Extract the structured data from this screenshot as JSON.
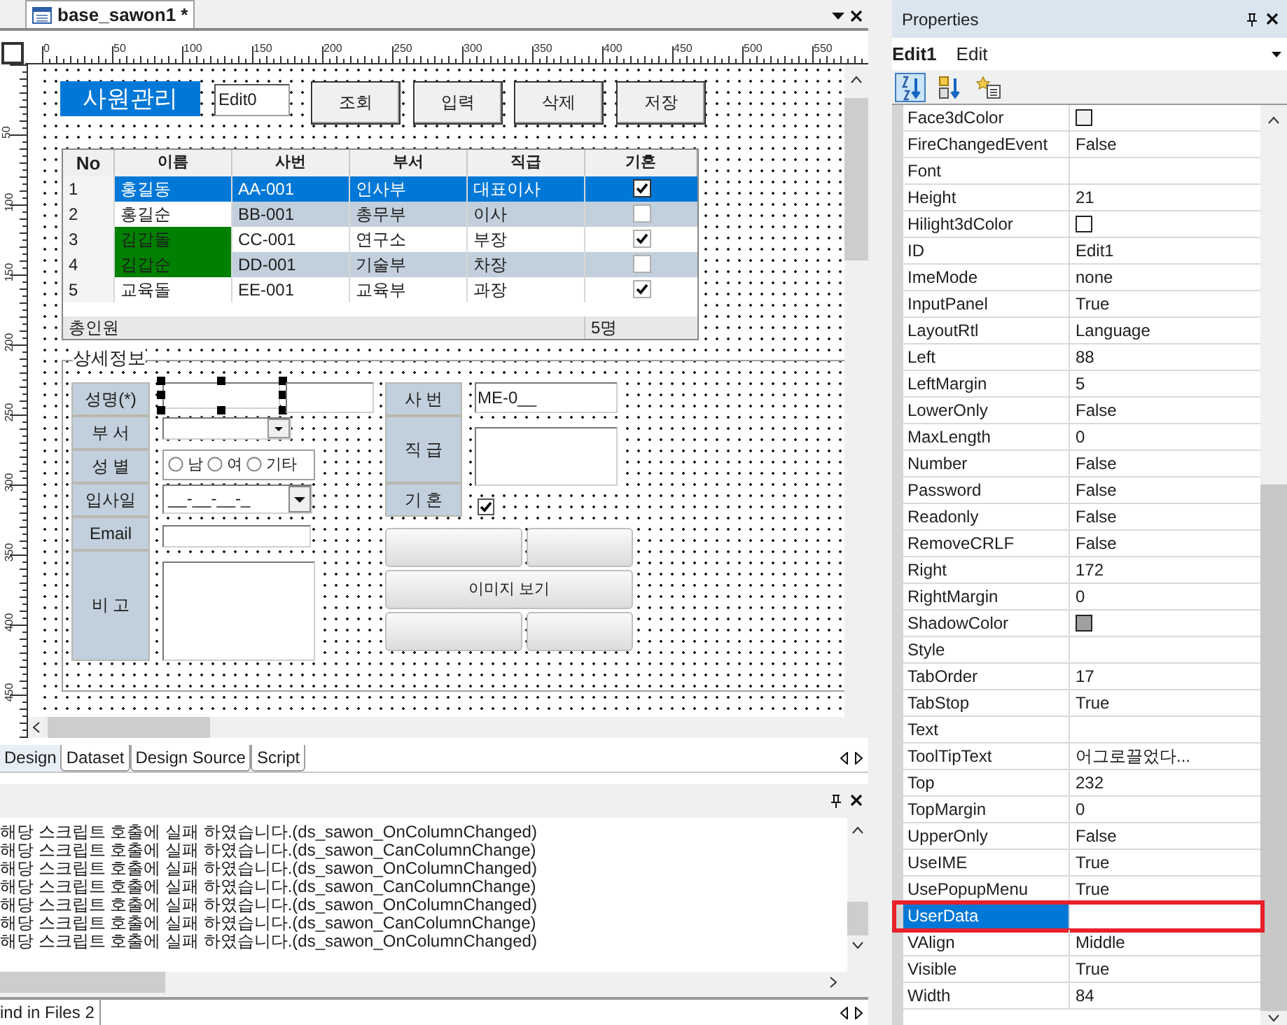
{
  "document_tab": {
    "title": "base_sawon1 *"
  },
  "ruler": {
    "horizontal": [
      "0",
      "50",
      "100",
      "150",
      "200",
      "250",
      "300",
      "350",
      "400",
      "450",
      "500",
      "550"
    ],
    "vertical": [
      "50",
      "100",
      "150",
      "200",
      "250",
      "300",
      "350",
      "400",
      "450"
    ]
  },
  "form": {
    "title": "사원관리",
    "edit0": "Edit0",
    "buttons": [
      "조회",
      "입력",
      "삭제",
      "저장"
    ],
    "grid": {
      "columns": [
        "No",
        "이름",
        "사번",
        "부서",
        "직급",
        "기혼"
      ],
      "rows": [
        {
          "no": "1",
          "name": "홍길동",
          "id": "AA-001",
          "dept": "인사부",
          "rank": "대표이사",
          "married": true,
          "selected": true,
          "striped": false,
          "highlighted": false
        },
        {
          "no": "2",
          "name": "홍길순",
          "id": "BB-001",
          "dept": "총무부",
          "rank": "이사",
          "married": false,
          "selected": false,
          "striped": true,
          "highlighted": false
        },
        {
          "no": "3",
          "name": "김갑돌",
          "id": "CC-001",
          "dept": "연구소",
          "rank": "부장",
          "married": true,
          "selected": false,
          "striped": false,
          "highlighted": true
        },
        {
          "no": "4",
          "name": "김갑순",
          "id": "DD-001",
          "dept": "기술부",
          "rank": "차장",
          "married": false,
          "selected": false,
          "striped": true,
          "highlighted": true
        },
        {
          "no": "5",
          "name": "교육돌",
          "id": "EE-001",
          "dept": "교육부",
          "rank": "과장",
          "married": true,
          "selected": false,
          "striped": false,
          "highlighted": false
        }
      ],
      "summary": {
        "label": "총인원",
        "value": "5명"
      }
    },
    "detail": {
      "legend": "상세정보",
      "labels": [
        "성명(*)",
        "부 서",
        "성 별",
        "입사일",
        "Email",
        "비 고"
      ],
      "right_labels": [
        "사 번",
        "직 급",
        "기 혼"
      ],
      "gender_options": [
        {
          "label": "남",
          "selected": false
        },
        {
          "label": "여",
          "selected": false
        },
        {
          "label": "기타",
          "selected": false
        }
      ],
      "date_mask": "__-__-__-_",
      "employee_no": "ME-0__",
      "married": true,
      "image_button": "이미지 보기"
    }
  },
  "view_tabs": [
    {
      "label": "Design",
      "selected": true
    },
    {
      "label": "Dataset",
      "selected": false
    },
    {
      "label": "Design Source",
      "selected": false
    },
    {
      "label": "Script",
      "selected": false
    }
  ],
  "output": {
    "lines": [
      "해당 스크립트 호출에 실패 하였습니다.(ds_sawon_OnColumnChanged)",
      "해당 스크립트 호출에 실패 하였습니다.(ds_sawon_CanColumnChange)",
      "해당 스크립트 호출에 실패 하였습니다.(ds_sawon_OnColumnChanged)",
      "해당 스크립트 호출에 실패 하였습니다.(ds_sawon_CanColumnChange)",
      "해당 스크립트 호출에 실패 하였습니다.(ds_sawon_OnColumnChanged)",
      "해당 스크립트 호출에 실패 하였습니다.(ds_sawon_CanColumnChange)",
      "해당 스크립트 호출에 실패 하였습니다.(ds_sawon_OnColumnChanged)"
    ]
  },
  "bottom_tab": {
    "label": "ind in Files 2"
  },
  "properties": {
    "title": "Properties",
    "object_name": "Edit1",
    "object_type": "Edit",
    "toolbar": [
      {
        "kind": "alphabetical",
        "selected": true
      },
      {
        "kind": "categorized",
        "selected": false
      },
      {
        "kind": "events",
        "selected": false
      }
    ],
    "rows": [
      {
        "name": "Face3dColor",
        "kind": "color",
        "color": "#f0f0f0",
        "selected": false,
        "marked": false
      },
      {
        "name": "FireChangedEvent",
        "kind": "text",
        "value": "False",
        "selected": false,
        "marked": false
      },
      {
        "name": "Font",
        "kind": "text",
        "selected": false,
        "marked": false
      },
      {
        "name": "Height",
        "kind": "text",
        "value": "21",
        "selected": false,
        "marked": false
      },
      {
        "name": "Hilight3dColor",
        "kind": "color",
        "color": "#ffffff",
        "selected": false,
        "marked": false
      },
      {
        "name": "ID",
        "kind": "text",
        "value": "Edit1",
        "selected": false,
        "marked": false
      },
      {
        "name": "ImeMode",
        "kind": "text",
        "value": "none",
        "selected": false,
        "marked": false
      },
      {
        "name": "InputPanel",
        "kind": "text",
        "value": "True",
        "selected": false,
        "marked": false
      },
      {
        "name": "LayoutRtl",
        "kind": "text",
        "value": "Language",
        "selected": false,
        "marked": false
      },
      {
        "name": "Left",
        "kind": "text",
        "value": "88",
        "selected": false,
        "marked": false
      },
      {
        "name": "LeftMargin",
        "kind": "text",
        "value": "5",
        "selected": false,
        "marked": false
      },
      {
        "name": "LowerOnly",
        "kind": "text",
        "value": "False",
        "selected": false,
        "marked": false
      },
      {
        "name": "MaxLength",
        "kind": "text",
        "value": "0",
        "selected": false,
        "marked": false
      },
      {
        "name": "Number",
        "kind": "text",
        "value": "False",
        "selected": false,
        "marked": false
      },
      {
        "name": "Password",
        "kind": "text",
        "value": "False",
        "selected": false,
        "marked": false
      },
      {
        "name": "Readonly",
        "kind": "text",
        "value": "False",
        "selected": false,
        "marked": false
      },
      {
        "name": "RemoveCRLF",
        "kind": "text",
        "value": "False",
        "selected": false,
        "marked": false
      },
      {
        "name": "Right",
        "kind": "text",
        "value": "172",
        "selected": false,
        "marked": false
      },
      {
        "name": "RightMargin",
        "kind": "text",
        "value": "0",
        "selected": false,
        "marked": false
      },
      {
        "name": "ShadowColor",
        "kind": "color",
        "color": "#a0a0a0",
        "selected": false,
        "marked": false
      },
      {
        "name": "Style",
        "kind": "text",
        "selected": false,
        "marked": false
      },
      {
        "name": "TabOrder",
        "kind": "text",
        "value": "17",
        "selected": false,
        "marked": false
      },
      {
        "name": "TabStop",
        "kind": "text",
        "value": "True",
        "selected": false,
        "marked": false
      },
      {
        "name": "Text",
        "kind": "text",
        "selected": false,
        "marked": false
      },
      {
        "name": "ToolTipText",
        "kind": "text",
        "value": "어그로끌었다...",
        "selected": false,
        "marked": false
      },
      {
        "name": "Top",
        "kind": "text",
        "value": "232",
        "selected": false,
        "marked": false
      },
      {
        "name": "TopMargin",
        "kind": "text",
        "value": "0",
        "selected": false,
        "marked": false
      },
      {
        "name": "UpperOnly",
        "kind": "text",
        "value": "False",
        "selected": false,
        "marked": false
      },
      {
        "name": "UseIME",
        "kind": "text",
        "value": "True",
        "selected": false,
        "marked": false
      },
      {
        "name": "UsePopupMenu",
        "kind": "text",
        "value": "True",
        "selected": false,
        "marked": false
      },
      {
        "name": "UserData",
        "kind": "text",
        "selected": true,
        "marked": true
      },
      {
        "name": "VAlign",
        "kind": "text",
        "value": "Middle",
        "selected": false,
        "marked": false
      },
      {
        "name": "Visible",
        "kind": "text",
        "value": "True",
        "selected": false,
        "marked": false
      },
      {
        "name": "Width",
        "kind": "text",
        "value": "84",
        "selected": false,
        "marked": false
      }
    ]
  }
}
